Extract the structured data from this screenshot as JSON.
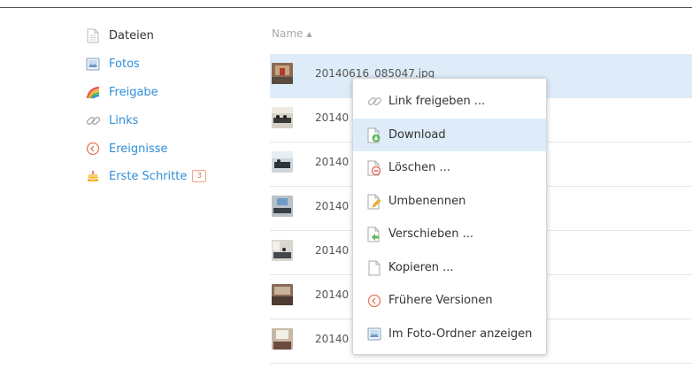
{
  "sidebar": {
    "items": [
      {
        "label": "Dateien",
        "icon": "file-icon"
      },
      {
        "label": "Fotos",
        "icon": "photo-icon"
      },
      {
        "label": "Freigabe",
        "icon": "share-icon"
      },
      {
        "label": "Links",
        "icon": "link-icon"
      },
      {
        "label": "Ereignisse",
        "icon": "history-icon"
      },
      {
        "label": "Erste Schritte",
        "icon": "cake-icon",
        "badge": "3"
      }
    ]
  },
  "list": {
    "column_header": "Name",
    "sort_indicator": "▲",
    "files": [
      {
        "name": "20140616_085047.jpg"
      },
      {
        "name": "20140"
      },
      {
        "name": "20140"
      },
      {
        "name": "20140"
      },
      {
        "name": "20140"
      },
      {
        "name": "20140"
      },
      {
        "name": "20140"
      }
    ]
  },
  "context_menu": {
    "items": [
      {
        "label": "Link freigeben ...",
        "icon": "link-icon"
      },
      {
        "label": "Download",
        "icon": "download-icon"
      },
      {
        "label": "Löschen ...",
        "icon": "delete-icon"
      },
      {
        "label": "Umbenennen",
        "icon": "rename-icon"
      },
      {
        "label": "Verschieben ...",
        "icon": "move-icon"
      },
      {
        "label": "Kopieren ...",
        "icon": "copy-icon"
      },
      {
        "label": "Frühere Versionen",
        "icon": "history-icon"
      },
      {
        "label": "Im Foto-Ordner anzeigen",
        "icon": "photo-icon"
      }
    ]
  },
  "colors": {
    "accent": "#2f8ed8",
    "selection": "#ddecf8",
    "badge": "#e7795d"
  }
}
